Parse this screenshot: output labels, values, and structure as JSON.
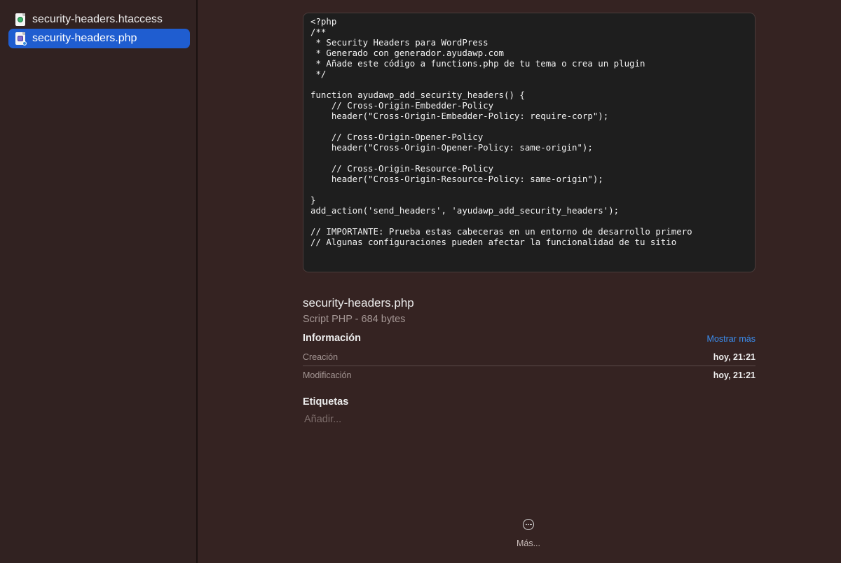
{
  "sidebar": {
    "files": [
      {
        "name": "security-headers.htaccess",
        "icon": "htaccess-file-icon",
        "selected": false
      },
      {
        "name": "security-headers.php",
        "icon": "php-file-icon",
        "selected": true
      }
    ]
  },
  "preview": {
    "code": "<?php\n/**\n * Security Headers para WordPress\n * Generado con generador.ayudawp.com\n * Añade este código a functions.php de tu tema o crea un plugin\n */\n\nfunction ayudawp_add_security_headers() {\n    // Cross-Origin-Embedder-Policy\n    header(\"Cross-Origin-Embedder-Policy: require-corp\");\n\n    // Cross-Origin-Opener-Policy\n    header(\"Cross-Origin-Opener-Policy: same-origin\");\n\n    // Cross-Origin-Resource-Policy\n    header(\"Cross-Origin-Resource-Policy: same-origin\");\n\n}\nadd_action('send_headers', 'ayudawp_add_security_headers');\n\n// IMPORTANTE: Prueba estas cabeceras en un entorno de desarrollo primero\n// Algunas configuraciones pueden afectar la funcionalidad de tu sitio"
  },
  "details": {
    "filename": "security-headers.php",
    "subtitle": "Script PHP - 684 bytes",
    "info_heading": "Información",
    "show_more": "Mostrar más",
    "rows": [
      {
        "key": "Creación",
        "value": "hoy, 21:21"
      },
      {
        "key": "Modificación",
        "value": "hoy, 21:21"
      }
    ],
    "tags_heading": "Etiquetas",
    "tags_placeholder": "Añadir..."
  },
  "footer": {
    "more_label": "Más...",
    "more_icon": "ellipsis-circle-icon"
  },
  "colors": {
    "accent": "#1f5dd0",
    "link": "#3b8ef0",
    "background": "#352322"
  }
}
